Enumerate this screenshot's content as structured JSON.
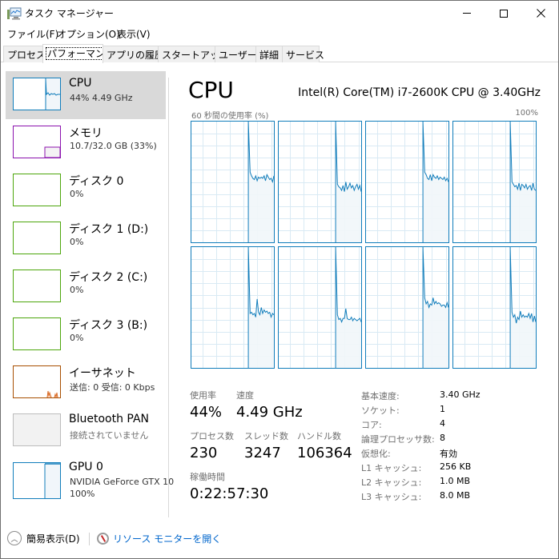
{
  "window": {
    "title": "タスク マネージャー",
    "controls": {
      "minimize": "—",
      "maximize": "☐",
      "close": "✕"
    }
  },
  "menu": [
    {
      "label": "ファイル(F)"
    },
    {
      "label": "オプション(O)"
    },
    {
      "label": "表示(V)"
    }
  ],
  "tabs": [
    {
      "label": "プロセス",
      "active": false
    },
    {
      "label": "パフォーマンス",
      "active": true
    },
    {
      "label": "アプリの履歴",
      "active": false
    },
    {
      "label": "スタートアップ",
      "active": false
    },
    {
      "label": "ユーザー",
      "active": false
    },
    {
      "label": "詳細",
      "active": false
    },
    {
      "label": "サービス",
      "active": false
    }
  ],
  "sidebar": {
    "items": [
      {
        "title": "CPU",
        "sub": "44%  4.49 GHz",
        "color": "#117dbb",
        "selected": true
      },
      {
        "title": "メモリ",
        "sub": "10.7/32.0 GB (33%)",
        "color": "#8b12ae",
        "selected": false
      },
      {
        "title": "ディスク 0",
        "sub": "0%",
        "color": "#4da60c",
        "selected": false
      },
      {
        "title": "ディスク 1 (D:)",
        "sub": "0%",
        "color": "#4da60c",
        "selected": false
      },
      {
        "title": "ディスク 2 (C:)",
        "sub": "0%",
        "color": "#4da60c",
        "selected": false
      },
      {
        "title": "ディスク 3 (B:)",
        "sub": "0%",
        "color": "#4da60c",
        "selected": false
      },
      {
        "title": "イーサネット",
        "sub": "送信: 0 受信: 0 Kbps",
        "color": "#a74f01",
        "selected": false
      },
      {
        "title": "Bluetooth PAN",
        "sub": "接続されていません",
        "color": "#bcbcbc",
        "selected": false
      },
      {
        "title": "GPU 0",
        "sub": "NVIDIA GeForce GTX 10",
        "sub2": "100%",
        "color": "#117dbb",
        "selected": false
      }
    ]
  },
  "main": {
    "title": "CPU",
    "model": "Intel(R) Core(TM) i7-2600K CPU @ 3.40GHz",
    "graph_label": "60 秒間の使用率 (%)",
    "graph_max": "100%",
    "accent": "#117dbb",
    "fill": "#f1f6fa",
    "grid": "#d9eaf4",
    "cores": [
      [
        0,
        0,
        0,
        0,
        0,
        0,
        0,
        0,
        0,
        0,
        0,
        0,
        0,
        0,
        0,
        0,
        0,
        0,
        0,
        0,
        0,
        0,
        0,
        0,
        0,
        0,
        0,
        0,
        0,
        0,
        0,
        0,
        0,
        0,
        0,
        0,
        0,
        0,
        0,
        0,
        0,
        100,
        58,
        55,
        53,
        52,
        55,
        51,
        54,
        53,
        54,
        53,
        55,
        51,
        56,
        54,
        52,
        53,
        50,
        55
      ],
      [
        0,
        0,
        0,
        0,
        0,
        0,
        0,
        0,
        0,
        0,
        0,
        0,
        0,
        0,
        0,
        0,
        0,
        0,
        0,
        0,
        0,
        0,
        0,
        0,
        0,
        0,
        0,
        0,
        0,
        0,
        0,
        0,
        0,
        0,
        0,
        0,
        0,
        0,
        0,
        0,
        0,
        100,
        48,
        46,
        45,
        43,
        47,
        42,
        50,
        44,
        46,
        49,
        45,
        47,
        43,
        46,
        48,
        44,
        47,
        42
      ],
      [
        0,
        0,
        0,
        0,
        0,
        0,
        0,
        0,
        0,
        0,
        0,
        0,
        0,
        0,
        0,
        0,
        0,
        0,
        0,
        0,
        0,
        0,
        0,
        0,
        0,
        0,
        0,
        0,
        0,
        0,
        0,
        0,
        0,
        0,
        0,
        0,
        0,
        0,
        0,
        0,
        0,
        100,
        58,
        56,
        53,
        52,
        56,
        51,
        56,
        54,
        53,
        55,
        52,
        54,
        53,
        52,
        54,
        51,
        53,
        50
      ],
      [
        0,
        0,
        0,
        0,
        0,
        0,
        0,
        0,
        0,
        0,
        0,
        0,
        0,
        0,
        0,
        0,
        0,
        0,
        0,
        0,
        0,
        0,
        0,
        0,
        0,
        0,
        0,
        0,
        0,
        0,
        0,
        0,
        0,
        0,
        0,
        0,
        0,
        0,
        0,
        0,
        0,
        100,
        50,
        48,
        46,
        47,
        44,
        49,
        43,
        48,
        47,
        45,
        48,
        44,
        46,
        47,
        43,
        49,
        44,
        43
      ],
      [
        0,
        0,
        0,
        0,
        0,
        0,
        0,
        0,
        0,
        0,
        0,
        0,
        0,
        0,
        0,
        0,
        0,
        0,
        0,
        0,
        0,
        0,
        0,
        0,
        0,
        0,
        0,
        0,
        0,
        0,
        0,
        0,
        0,
        0,
        0,
        0,
        0,
        0,
        0,
        0,
        0,
        100,
        45,
        46,
        44,
        45,
        42,
        57,
        46,
        44,
        50,
        45,
        48,
        46,
        47,
        45,
        46,
        42,
        45,
        44
      ],
      [
        0,
        0,
        0,
        0,
        0,
        0,
        0,
        0,
        0,
        0,
        0,
        0,
        0,
        0,
        0,
        0,
        0,
        0,
        0,
        0,
        0,
        0,
        0,
        0,
        0,
        0,
        0,
        0,
        0,
        0,
        0,
        0,
        0,
        0,
        0,
        0,
        0,
        0,
        0,
        0,
        0,
        100,
        44,
        40,
        41,
        38,
        41,
        41,
        49,
        41,
        40,
        40,
        42,
        39,
        41,
        40,
        39,
        40,
        41,
        38
      ],
      [
        0,
        0,
        0,
        0,
        0,
        0,
        0,
        0,
        0,
        0,
        0,
        0,
        0,
        0,
        0,
        0,
        0,
        0,
        0,
        0,
        0,
        0,
        0,
        0,
        0,
        0,
        0,
        0,
        0,
        0,
        0,
        0,
        0,
        0,
        0,
        0,
        0,
        0,
        0,
        0,
        0,
        100,
        58,
        53,
        55,
        50,
        53,
        52,
        58,
        53,
        55,
        53,
        54,
        53,
        51,
        52,
        52,
        50,
        54,
        50
      ],
      [
        0,
        0,
        0,
        0,
        0,
        0,
        0,
        0,
        0,
        0,
        0,
        0,
        0,
        0,
        0,
        0,
        0,
        0,
        0,
        0,
        0,
        0,
        0,
        0,
        0,
        0,
        0,
        0,
        0,
        0,
        0,
        0,
        0,
        0,
        0,
        0,
        0,
        0,
        0,
        0,
        0,
        100,
        46,
        42,
        44,
        37,
        42,
        40,
        47,
        42,
        44,
        42,
        43,
        42,
        45,
        41,
        45,
        38,
        43,
        38
      ]
    ],
    "stats": {
      "usage_label": "使用率",
      "usage_value": "44%",
      "speed_label": "速度",
      "speed_value": "4.49 GHz",
      "processes_label": "プロセス数",
      "processes_value": "230",
      "threads_label": "スレッド数",
      "threads_value": "3247",
      "handles_label": "ハンドル数",
      "handles_value": "106364",
      "uptime_label": "稼働時間",
      "uptime_value": "0:22:57:30"
    },
    "specs": [
      {
        "label": "基本速度:",
        "value": "3.40 GHz"
      },
      {
        "label": "ソケット:",
        "value": "1"
      },
      {
        "label": "コア:",
        "value": "4"
      },
      {
        "label": "論理プロセッサ数:",
        "value": "8"
      },
      {
        "label": "仮想化:",
        "value": "有効"
      },
      {
        "label": "L1 キャッシュ:",
        "value": "256 KB"
      },
      {
        "label": "L2 キャッシュ:",
        "value": "1.0 MB"
      },
      {
        "label": "L3 キャッシュ:",
        "value": "8.0 MB"
      }
    ]
  },
  "footer": {
    "fewer_details": "簡易表示(D)",
    "resource_monitor": "リソース モニターを開く"
  }
}
